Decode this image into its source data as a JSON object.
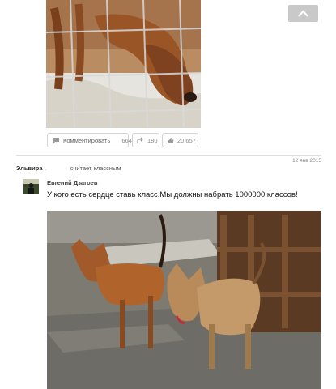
{
  "scroll_top": {
    "icon": "chevron-up-icon"
  },
  "actions": {
    "comment_label": "Комментировать",
    "comment_count": "664",
    "reshare_count": "180",
    "class_count": "20 657"
  },
  "post": {
    "date": "12 янв 2015",
    "liker_name": "Эльвира .",
    "liker_text": "считает классным",
    "author_name": "Евгений Дзагоев",
    "text": "У кого есть сердце ставь класс.Мы должны набрать 1000000 классов!"
  },
  "colors": {
    "accent": "#ee8208",
    "link": "#3f3f3f"
  }
}
